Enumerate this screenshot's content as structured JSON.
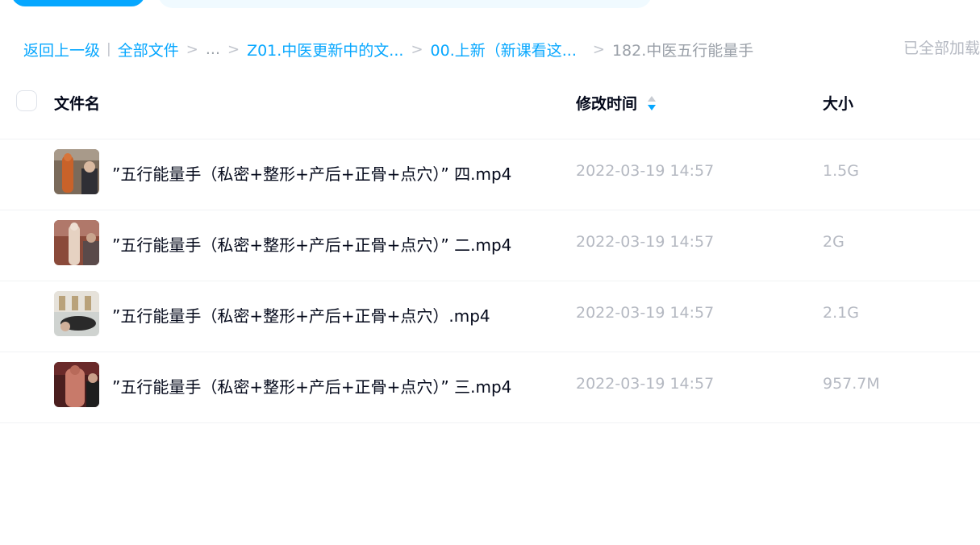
{
  "breadcrumb": {
    "back": "返回上一级",
    "all_files": "全部文件",
    "ellipsis": "...",
    "level1": "Z01.中医更新中的文...",
    "level2": "00.上新（新课看这...",
    "current": "182.中医五行能量手"
  },
  "status": {
    "loaded_text": "已全部加载"
  },
  "header": {
    "name_col": "文件名",
    "time_col": "修改时间",
    "size_col": "大小"
  },
  "files": [
    {
      "name": "”五行能量手（私密+整形+产后+正骨+点穴）” 四.mp4",
      "modified": "2022-03-19 14:57",
      "size": "1.5G"
    },
    {
      "name": "”五行能量手（私密+整形+产后+正骨+点穴）” 二.mp4",
      "modified": "2022-03-19 14:57",
      "size": "2G"
    },
    {
      "name": "”五行能量手（私密+整形+产后+正骨+点穴）.mp4",
      "modified": "2022-03-19 14:57",
      "size": "2.1G"
    },
    {
      "name": "”五行能量手（私密+整形+产后+正骨+点穴）” 三.mp4",
      "modified": "2022-03-19 14:57",
      "size": "957.7M"
    }
  ],
  "colors": {
    "accent": "#06a7ff",
    "text_primary": "#03081a",
    "text_secondary": "#b5b9c2"
  },
  "icons": {
    "sort": "sort-icon",
    "thumbnail": "video-thumbnail"
  }
}
